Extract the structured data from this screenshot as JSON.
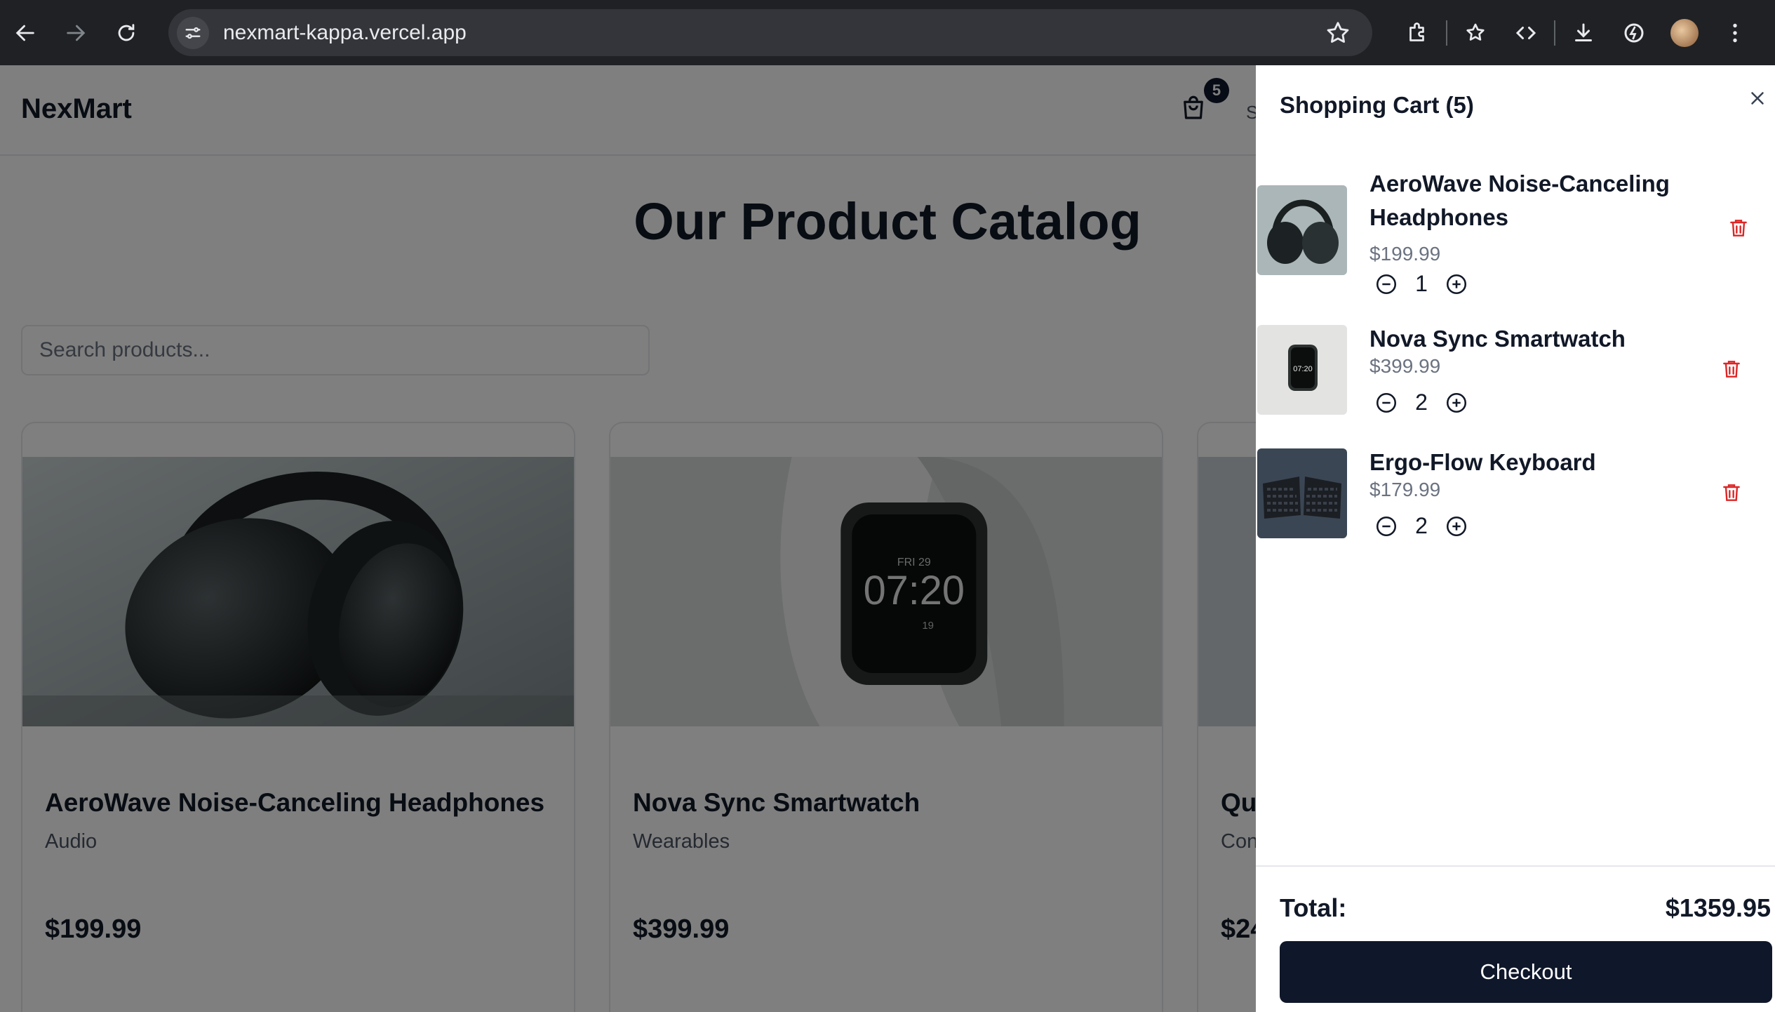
{
  "browser": {
    "url": "nexmart-kappa.vercel.app"
  },
  "header": {
    "logo": "NexMart",
    "cart_count": "5",
    "peek_text": "S"
  },
  "catalog": {
    "title": "Our Product Catalog",
    "search_placeholder": "Search products...",
    "products": [
      {
        "name": "AeroWave Noise-Canceling Headphones",
        "category": "Audio",
        "price": "$199.99"
      },
      {
        "name": "Nova Sync Smartwatch",
        "category": "Wearables",
        "price": "$399.99"
      },
      {
        "name": "Qu",
        "category": "Con",
        "price": "$24"
      }
    ]
  },
  "cart": {
    "title": "Shopping Cart (5)",
    "items": [
      {
        "name": "AeroWave Noise-Canceling Headphones",
        "price": "$199.99",
        "qty": "1"
      },
      {
        "name": "Nova Sync Smartwatch",
        "price": "$399.99",
        "qty": "2"
      },
      {
        "name": "Ergo-Flow Keyboard",
        "price": "$179.99",
        "qty": "2"
      }
    ],
    "total_label": "Total:",
    "total_value": "$1359.95",
    "checkout_label": "Checkout"
  },
  "watch_face": {
    "day": "FRI",
    "date": "29",
    "time": "07:20",
    "steps": "19"
  },
  "colors": {
    "accent_dark": "#0f172a",
    "trash_red": "#dc2626",
    "chrome_bg": "#202124"
  }
}
